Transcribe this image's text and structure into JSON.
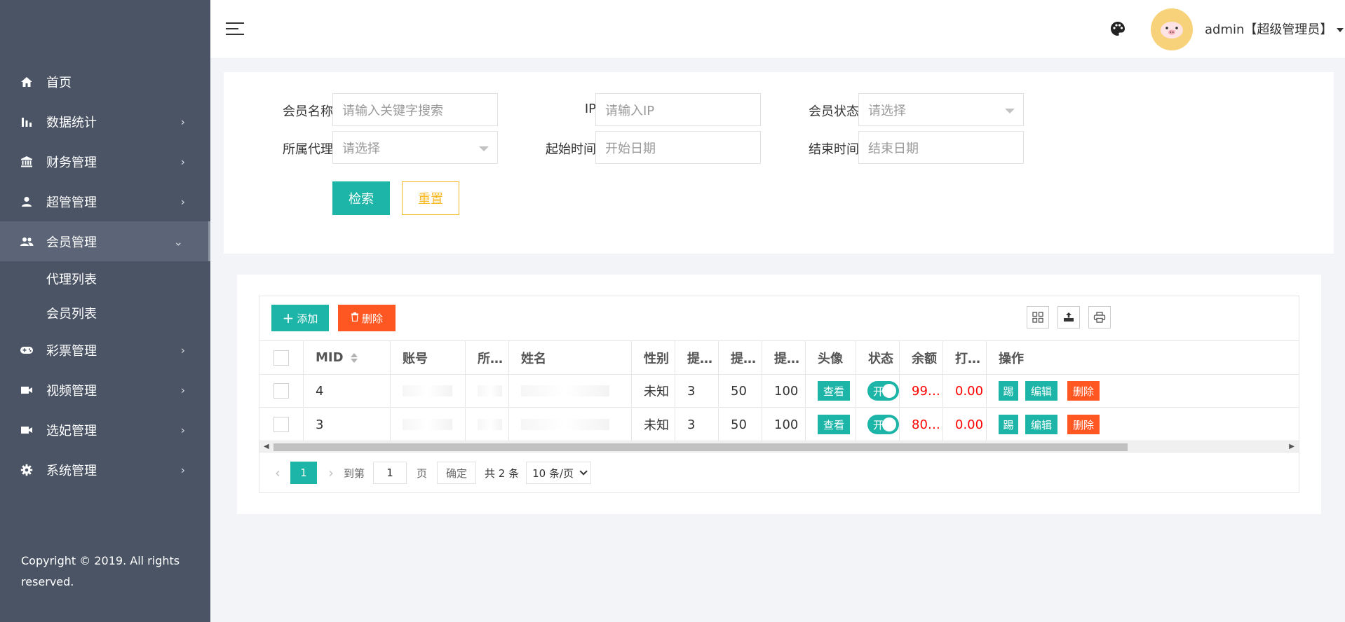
{
  "sidebar": {
    "menu": [
      {
        "label": "首页",
        "icon": "home-icon"
      },
      {
        "label": "数据统计",
        "icon": "bar-chart-icon"
      },
      {
        "label": "财务管理",
        "icon": "bank-icon"
      },
      {
        "label": "超管管理",
        "icon": "user-icon"
      },
      {
        "label": "会员管理",
        "icon": "users-icon"
      },
      {
        "label": "彩票管理",
        "icon": "gamepad-icon"
      },
      {
        "label": "视频管理",
        "icon": "video-icon"
      },
      {
        "label": "选妃管理",
        "icon": "video-icon"
      },
      {
        "label": "系统管理",
        "icon": "gear-icon"
      }
    ],
    "submenu": [
      {
        "label": "代理列表"
      },
      {
        "label": "会员列表"
      }
    ],
    "copyright": "Copyright © 2019. All rights reserved."
  },
  "header": {
    "user": "admin【超级管理员】"
  },
  "search": {
    "member_name_label": "会员名称",
    "member_name_placeholder": "请输入关键字搜索",
    "ip_label": "IP",
    "ip_placeholder": "请输入IP",
    "status_label": "会员状态",
    "status_placeholder": "请选择",
    "agent_label": "所属代理",
    "agent_placeholder": "请选择",
    "start_label": "起始时间",
    "start_placeholder": "开始日期",
    "end_label": "结束时间",
    "end_placeholder": "结束日期",
    "search_btn": "检索",
    "reset_btn": "重置"
  },
  "toolbar": {
    "add_label": "添加",
    "delete_label": "删除"
  },
  "table": {
    "headers": {
      "mid": "MID",
      "account": "账号",
      "agent": "所…",
      "name": "姓名",
      "gender": "性别",
      "c1": "提…",
      "c2": "提…",
      "c3": "提…",
      "avatar": "头像",
      "status": "状态",
      "balance": "余额",
      "c4": "打…",
      "ops": "操作"
    },
    "rows": [
      {
        "mid": "4",
        "gender": "未知",
        "c1": "3",
        "c2": "50",
        "c3": "100",
        "view": "查看",
        "status": "开启",
        "balance": "99…",
        "c4": "0.00",
        "kick": "踢",
        "edit": "编辑",
        "del": "删除"
      },
      {
        "mid": "3",
        "gender": "未知",
        "c1": "3",
        "c2": "50",
        "c3": "100",
        "view": "查看",
        "status": "开启",
        "balance": "80…",
        "c4": "0.00",
        "kick": "踢",
        "edit": "编辑",
        "del": "删除"
      }
    ]
  },
  "pager": {
    "current": "1",
    "goto": "到第",
    "page_input": "1",
    "page_unit": "页",
    "confirm": "确定",
    "total": "共 2 条",
    "per_page": "10 条/页"
  }
}
